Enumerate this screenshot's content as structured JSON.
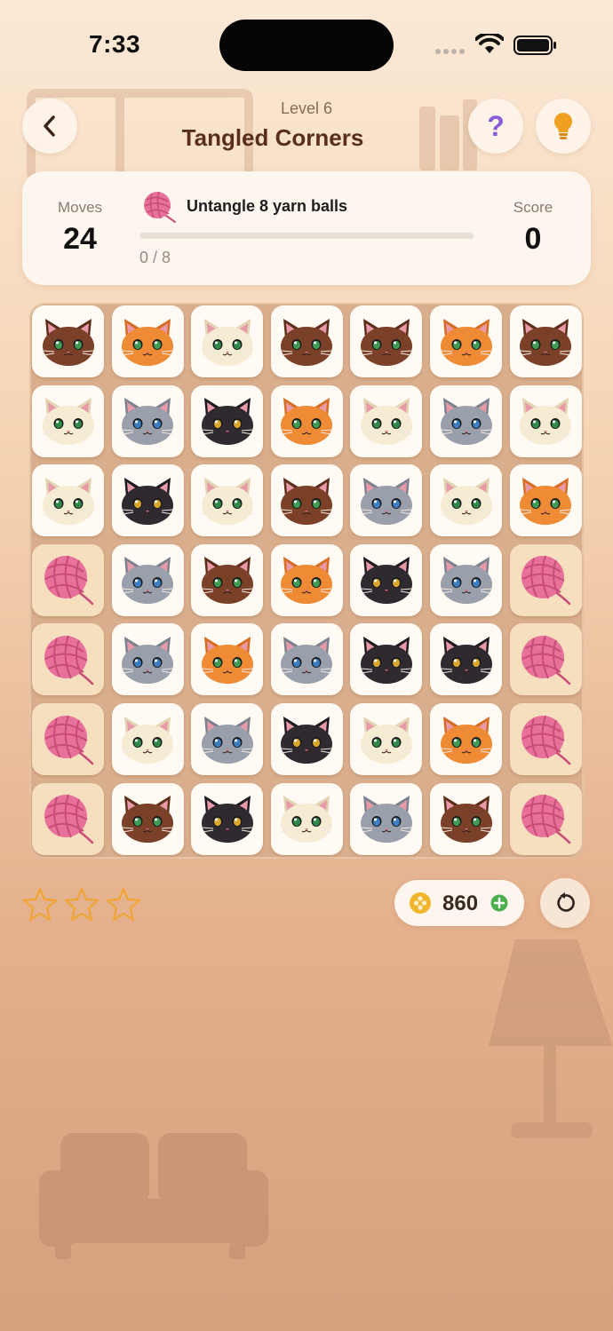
{
  "status_bar": {
    "time": "7:33"
  },
  "header": {
    "level_label": "Level 6",
    "title": "Tangled Corners",
    "help_symbol": "?",
    "icons": [
      "back-chevron-icon",
      "question-icon",
      "lightbulb-icon"
    ]
  },
  "goal_card": {
    "moves_label": "Moves",
    "moves_value": "24",
    "goal_text": "Untangle 8 yarn balls",
    "goal_progress_text": "0 / 8",
    "goal_progress_fraction": 0,
    "score_label": "Score",
    "score_value": "0"
  },
  "board": {
    "rows": 7,
    "cols": 7,
    "grid": [
      [
        "brown",
        "orange",
        "cream",
        "brown",
        "brown",
        "orange",
        "brown"
      ],
      [
        "cream",
        "gray",
        "black",
        "orange",
        "cream",
        "gray",
        "cream"
      ],
      [
        "cream",
        "black",
        "cream",
        "brown",
        "gray",
        "cream",
        "orange"
      ],
      [
        "yarn",
        "gray",
        "brown",
        "orange",
        "black",
        "gray",
        "yarn"
      ],
      [
        "yarn",
        "gray",
        "orange",
        "gray",
        "black",
        "black",
        "yarn"
      ],
      [
        "yarn",
        "cream",
        "gray",
        "black",
        "cream",
        "orange",
        "yarn"
      ],
      [
        "yarn",
        "brown",
        "black",
        "cream",
        "gray",
        "brown",
        "yarn"
      ]
    ]
  },
  "footer": {
    "stars_earned": 0,
    "stars_total": 3,
    "coins": "860",
    "icons": [
      "coin-icon",
      "plus-icon",
      "restart-icon"
    ]
  },
  "colors": {
    "accent_pink": "#e96e95",
    "star_outline": "#f0a53a",
    "help_purple": "#8a5ad8",
    "bulb_orange": "#f0a020",
    "plus_green": "#4cb050"
  },
  "cat_palette": {
    "brown": {
      "body": "#7a4128",
      "ear": "#5c2d1b",
      "eye": "#3f9a54"
    },
    "orange": {
      "body": "#ef8a35",
      "ear": "#d76c22",
      "eye": "#3f9a54"
    },
    "cream": {
      "body": "#f6ecd3",
      "ear": "#e2d3b2",
      "eye": "#2f8a4a"
    },
    "gray": {
      "body": "#9aa0ab",
      "ear": "#7c828e",
      "eye": "#3c7dc2"
    },
    "black": {
      "body": "#2e2a30",
      "ear": "#1d1a1f",
      "eye": "#d9a62c"
    }
  }
}
